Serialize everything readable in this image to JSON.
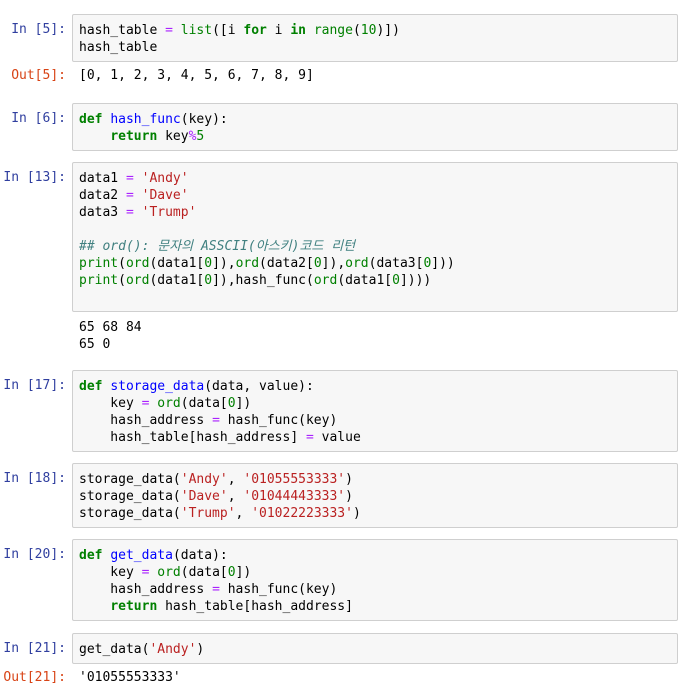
{
  "cells": [
    {
      "prompt": "In [5]:",
      "code": [
        [
          [
            "t",
            "hash_table "
          ],
          [
            "op",
            "="
          ],
          [
            "t",
            " "
          ],
          [
            "bi",
            "list"
          ],
          [
            "t",
            "([i "
          ],
          [
            "kw",
            "for"
          ],
          [
            "t",
            " i "
          ],
          [
            "kw",
            "in"
          ],
          [
            "t",
            " "
          ],
          [
            "bi",
            "range"
          ],
          [
            "t",
            "("
          ],
          [
            "num",
            "10"
          ],
          [
            "t",
            ")])"
          ]
        ],
        [
          [
            "t",
            "hash_table"
          ]
        ]
      ],
      "out_prompt": "Out[5]:",
      "output": "[0, 1, 2, 3, 4, 5, 6, 7, 8, 9]"
    },
    {
      "prompt": "In [6]:",
      "code": [
        [
          [
            "kw",
            "def"
          ],
          [
            "t",
            " "
          ],
          [
            "fn",
            "hash_func"
          ],
          [
            "t",
            "(key):"
          ]
        ],
        [
          [
            "t",
            "    "
          ],
          [
            "kw",
            "return"
          ],
          [
            "t",
            " key"
          ],
          [
            "op",
            "%"
          ],
          [
            "num",
            "5"
          ]
        ]
      ]
    },
    {
      "prompt": "In [13]:",
      "code": [
        [
          [
            "t",
            "data1 "
          ],
          [
            "op",
            "="
          ],
          [
            "t",
            " "
          ],
          [
            "str",
            "'Andy'"
          ]
        ],
        [
          [
            "t",
            "data2 "
          ],
          [
            "op",
            "="
          ],
          [
            "t",
            " "
          ],
          [
            "str",
            "'Dave'"
          ]
        ],
        [
          [
            "t",
            "data3 "
          ],
          [
            "op",
            "="
          ],
          [
            "t",
            " "
          ],
          [
            "str",
            "'Trump'"
          ]
        ],
        [
          [
            "t",
            ""
          ]
        ],
        [
          [
            "cm",
            "## ord(): 문자의 ASSCII(아스키)코드 리턴"
          ]
        ],
        [
          [
            "bi",
            "print"
          ],
          [
            "t",
            "("
          ],
          [
            "bi",
            "ord"
          ],
          [
            "t",
            "(data1["
          ],
          [
            "num",
            "0"
          ],
          [
            "t",
            "]),"
          ],
          [
            "bi",
            "ord"
          ],
          [
            "t",
            "(data2["
          ],
          [
            "num",
            "0"
          ],
          [
            "t",
            "]),"
          ],
          [
            "bi",
            "ord"
          ],
          [
            "t",
            "(data3["
          ],
          [
            "num",
            "0"
          ],
          [
            "t",
            "]))"
          ]
        ],
        [
          [
            "bi",
            "print"
          ],
          [
            "t",
            "("
          ],
          [
            "bi",
            "ord"
          ],
          [
            "t",
            "(data1["
          ],
          [
            "num",
            "0"
          ],
          [
            "t",
            "]),hash_func("
          ],
          [
            "bi",
            "ord"
          ],
          [
            "t",
            "(data1["
          ],
          [
            "num",
            "0"
          ],
          [
            "t",
            "])))"
          ]
        ],
        [
          [
            "t",
            ""
          ]
        ]
      ],
      "output": "65 68 84\n65 0"
    },
    {
      "prompt": "In [17]:",
      "code": [
        [
          [
            "kw",
            "def"
          ],
          [
            "t",
            " "
          ],
          [
            "fn",
            "storage_data"
          ],
          [
            "t",
            "(data, value):"
          ]
        ],
        [
          [
            "t",
            "    key "
          ],
          [
            "op",
            "="
          ],
          [
            "t",
            " "
          ],
          [
            "bi",
            "ord"
          ],
          [
            "t",
            "(data["
          ],
          [
            "num",
            "0"
          ],
          [
            "t",
            "])"
          ]
        ],
        [
          [
            "t",
            "    hash_address "
          ],
          [
            "op",
            "="
          ],
          [
            "t",
            " hash_func(key)"
          ]
        ],
        [
          [
            "t",
            "    hash_table[hash_address] "
          ],
          [
            "op",
            "="
          ],
          [
            "t",
            " value"
          ]
        ]
      ]
    },
    {
      "prompt": "In [18]:",
      "code": [
        [
          [
            "t",
            "storage_data("
          ],
          [
            "str",
            "'Andy'"
          ],
          [
            "t",
            ", "
          ],
          [
            "str",
            "'01055553333'"
          ],
          [
            "t",
            ")"
          ]
        ],
        [
          [
            "t",
            "storage_data("
          ],
          [
            "str",
            "'Dave'"
          ],
          [
            "t",
            ", "
          ],
          [
            "str",
            "'01044443333'"
          ],
          [
            "t",
            ")"
          ]
        ],
        [
          [
            "t",
            "storage_data("
          ],
          [
            "str",
            "'Trump'"
          ],
          [
            "t",
            ", "
          ],
          [
            "str",
            "'01022223333'"
          ],
          [
            "t",
            ")"
          ]
        ]
      ]
    },
    {
      "prompt": "In [20]:",
      "code": [
        [
          [
            "kw",
            "def"
          ],
          [
            "t",
            " "
          ],
          [
            "fn",
            "get_data"
          ],
          [
            "t",
            "(data):"
          ]
        ],
        [
          [
            "t",
            "    key "
          ],
          [
            "op",
            "="
          ],
          [
            "t",
            " "
          ],
          [
            "bi",
            "ord"
          ],
          [
            "t",
            "(data["
          ],
          [
            "num",
            "0"
          ],
          [
            "t",
            "])"
          ]
        ],
        [
          [
            "t",
            "    hash_address "
          ],
          [
            "op",
            "="
          ],
          [
            "t",
            " hash_func(key)"
          ]
        ],
        [
          [
            "t",
            "    "
          ],
          [
            "kw",
            "return"
          ],
          [
            "t",
            " hash_table[hash_address]"
          ]
        ]
      ]
    },
    {
      "prompt": "In [21]:",
      "code": [
        [
          [
            "t",
            "get_data("
          ],
          [
            "str",
            "'Andy'"
          ],
          [
            "t",
            ")"
          ]
        ]
      ],
      "out_prompt": "Out[21]:",
      "output": "'01055553333'"
    }
  ]
}
